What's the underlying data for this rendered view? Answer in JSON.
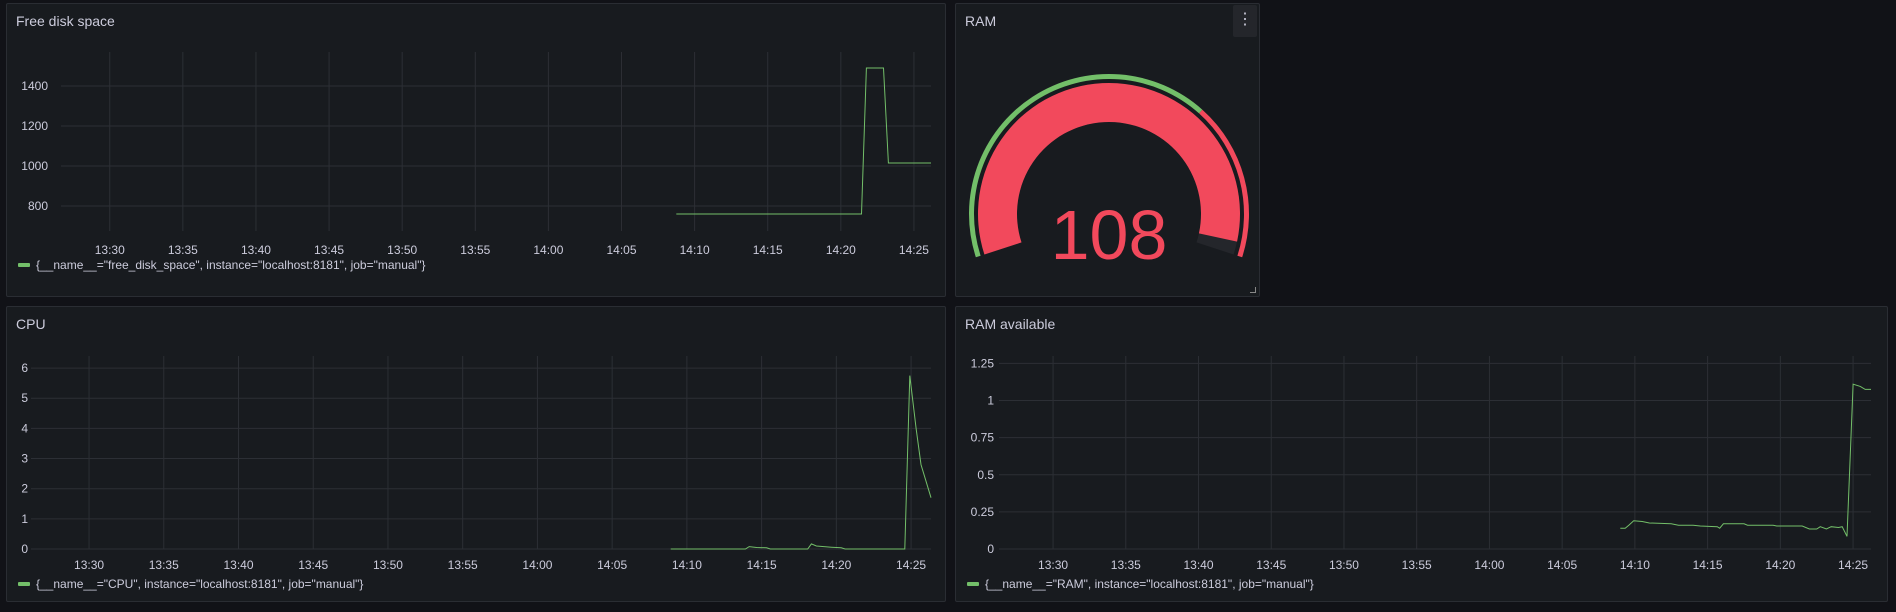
{
  "colors": {
    "background": "#111217",
    "panel": "#181b1f",
    "series": "#73bf69",
    "red": "#f2495c",
    "grid": "#2c2f35",
    "text": "#ccccdc"
  },
  "panels": {
    "disk": {
      "title": "Free disk space",
      "legend": "{__name__=\"free_disk_space\", instance=\"localhost:8181\", job=\"manual\"}"
    },
    "ram_gauge": {
      "title": "RAM",
      "menu_icon": "more-vertical-icon",
      "value_text": "108"
    },
    "cpu": {
      "title": "CPU",
      "legend": "{__name__=\"CPU\", instance=\"localhost:8181\", job=\"manual\"}"
    },
    "ram_avail": {
      "title": "RAM available",
      "legend": "{__name__=\"RAM\", instance=\"localhost:8181\", job=\"manual\"}"
    }
  },
  "chart_data": [
    {
      "id": "disk",
      "type": "line",
      "title": "Free disk space",
      "xlim": [
        "13:26:40",
        "14:26:10"
      ],
      "ylim": [
        675,
        1570
      ],
      "xticks": [
        "13:30",
        "13:35",
        "13:40",
        "13:45",
        "13:50",
        "13:55",
        "14:00",
        "14:05",
        "14:10",
        "14:15",
        "14:20",
        "14:25"
      ],
      "yticks": [
        {
          "v": 800,
          "label": "800"
        },
        {
          "v": 1000,
          "label": "1000"
        },
        {
          "v": 1200,
          "label": "1200"
        },
        {
          "v": 1400,
          "label": "1400"
        }
      ],
      "series": [
        {
          "name": "free_disk_space",
          "points": [
            [
              "14:08:45",
              760
            ],
            [
              "14:21:25",
              760
            ],
            [
              "14:21:45",
              1490
            ],
            [
              "14:22:55",
              1490
            ],
            [
              "14:23:15",
              1015
            ],
            [
              "14:26:10",
              1015
            ]
          ]
        }
      ]
    },
    {
      "id": "cpu",
      "type": "line",
      "title": "CPU",
      "xlim": [
        "13:26:07",
        "14:26:20"
      ],
      "ylim": [
        0,
        6.4
      ],
      "xticks": [
        "13:30",
        "13:35",
        "13:40",
        "13:45",
        "13:50",
        "13:55",
        "14:00",
        "14:05",
        "14:10",
        "14:15",
        "14:20",
        "14:25"
      ],
      "yticks": [
        {
          "v": 0,
          "label": "0"
        },
        {
          "v": 1,
          "label": "1"
        },
        {
          "v": 2,
          "label": "2"
        },
        {
          "v": 3,
          "label": "3"
        },
        {
          "v": 4,
          "label": "4"
        },
        {
          "v": 5,
          "label": "5"
        },
        {
          "v": 6,
          "label": "6"
        }
      ],
      "series": [
        {
          "name": "CPU",
          "points": [
            [
              "14:08:55",
              0
            ],
            [
              "14:13:55",
              0
            ],
            [
              "14:14:10",
              0.08
            ],
            [
              "14:14:40",
              0.05
            ],
            [
              "14:15:20",
              0.04
            ],
            [
              "14:15:35",
              0
            ],
            [
              "14:18:05",
              0
            ],
            [
              "14:18:20",
              0.17
            ],
            [
              "14:18:40",
              0.1
            ],
            [
              "14:19:40",
              0.06
            ],
            [
              "14:20:20",
              0.04
            ],
            [
              "14:20:35",
              0
            ],
            [
              "14:24:35",
              0
            ],
            [
              "14:24:55",
              5.75
            ],
            [
              "14:25:20",
              4.0
            ],
            [
              "14:25:40",
              2.8
            ],
            [
              "14:26:20",
              1.7
            ]
          ]
        }
      ]
    },
    {
      "id": "ram_avail",
      "type": "line",
      "title": "RAM available",
      "xlim": [
        "13:26:17",
        "14:26:14"
      ],
      "ylim": [
        0,
        1.3
      ],
      "xticks": [
        "13:30",
        "13:35",
        "13:40",
        "13:45",
        "13:50",
        "13:55",
        "14:00",
        "14:05",
        "14:10",
        "14:15",
        "14:20",
        "14:25"
      ],
      "yticks": [
        {
          "v": 0,
          "label": "0"
        },
        {
          "v": 0.25,
          "label": "0.25"
        },
        {
          "v": 0.5,
          "label": "0.5"
        },
        {
          "v": 0.75,
          "label": "0.75"
        },
        {
          "v": 1,
          "label": "1"
        },
        {
          "v": 1.25,
          "label": "1.25"
        }
      ],
      "series": [
        {
          "name": "RAM",
          "points": [
            [
              "14:09:00",
              0.14
            ],
            [
              "14:09:20",
              0.14
            ],
            [
              "14:09:35",
              0.16
            ],
            [
              "14:09:55",
              0.19
            ],
            [
              "14:10:30",
              0.185
            ],
            [
              "14:11:00",
              0.175
            ],
            [
              "14:12:30",
              0.17
            ],
            [
              "14:13:00",
              0.16
            ],
            [
              "14:14:00",
              0.16
            ],
            [
              "14:14:30",
              0.155
            ],
            [
              "14:15:40",
              0.15
            ],
            [
              "14:15:50",
              0.14
            ],
            [
              "14:16:05",
              0.17
            ],
            [
              "14:17:30",
              0.17
            ],
            [
              "14:17:45",
              0.16
            ],
            [
              "14:19:30",
              0.16
            ],
            [
              "14:19:45",
              0.155
            ],
            [
              "14:21:30",
              0.155
            ],
            [
              "14:22:00",
              0.135
            ],
            [
              "14:22:30",
              0.135
            ],
            [
              "14:22:45",
              0.15
            ],
            [
              "14:23:10",
              0.135
            ],
            [
              "14:23:30",
              0.15
            ],
            [
              "14:24:00",
              0.145
            ],
            [
              "14:24:15",
              0.15
            ],
            [
              "14:24:35",
              0.085
            ],
            [
              "14:25:00",
              1.11
            ],
            [
              "14:25:30",
              1.095
            ],
            [
              "14:25:50",
              1.075
            ],
            [
              "14:26:14",
              1.075
            ]
          ]
        }
      ]
    },
    {
      "id": "ram_gauge",
      "type": "gauge",
      "title": "RAM",
      "value": 108,
      "min": 0,
      "max": 111,
      "thresholds": [
        {
          "from": 0,
          "color": "#73bf69"
        },
        {
          "from": 77,
          "color": "#f2495c"
        }
      ]
    }
  ]
}
